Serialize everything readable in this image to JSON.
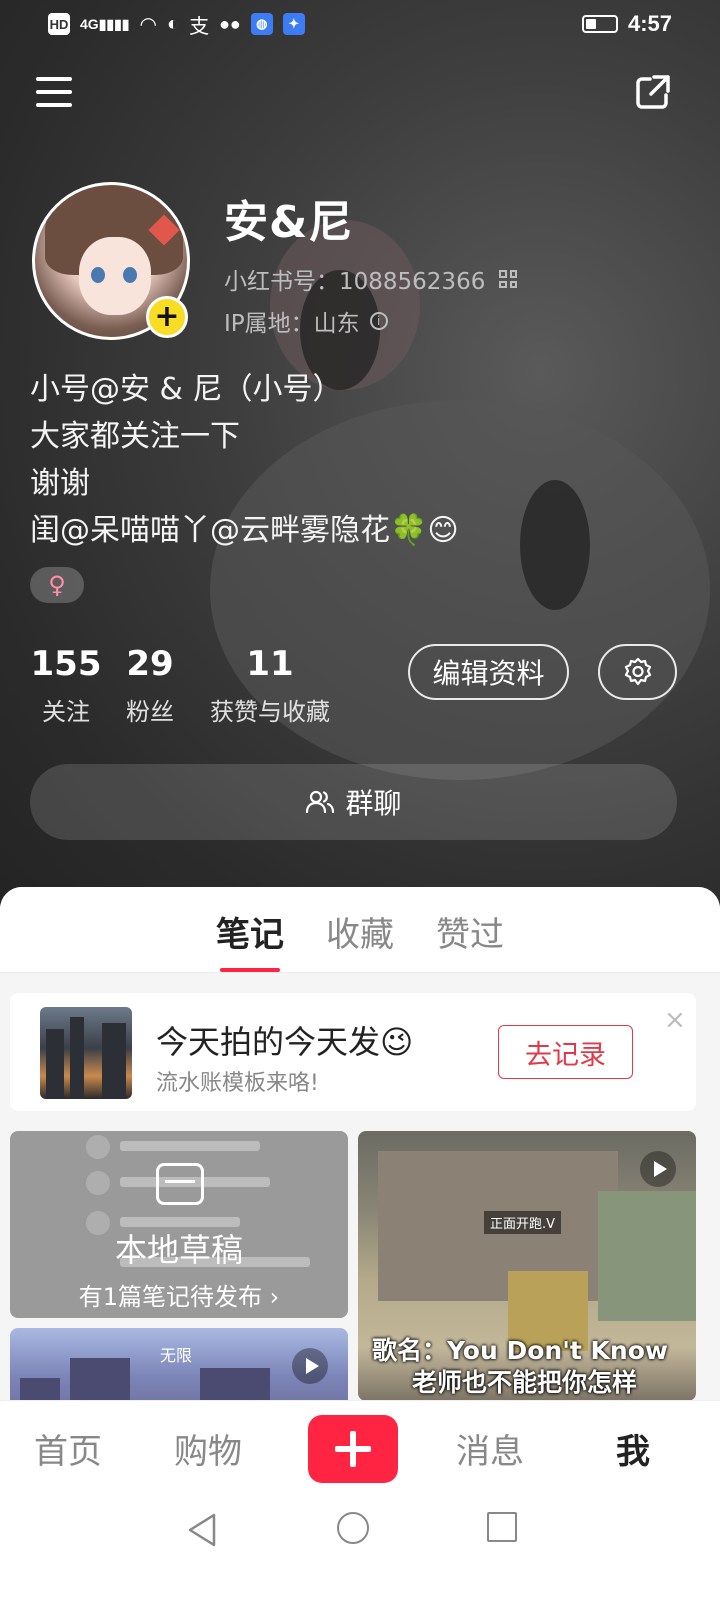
{
  "status_bar": {
    "left_labels": [
      "HD",
      "4G"
    ],
    "time": "4:57",
    "alipay_glyph": "支"
  },
  "profile": {
    "name": "安&尼",
    "id_label": "小红书号：1088562366",
    "ip_label": "IP属地：山东",
    "add_glyph": "+",
    "bio_lines": [
      "小号@安 & 尼（小号）",
      "大家都关注一下",
      "谢谢",
      "闺@呆喵喵丫@云畔雾隐花🍀😊"
    ],
    "gender_symbol": "♀",
    "gender_color": "#ff8fa4"
  },
  "stats": [
    {
      "value": "155",
      "label": "关注"
    },
    {
      "value": "29",
      "label": "粉丝"
    },
    {
      "value": "11",
      "label": "获赞与收藏"
    }
  ],
  "actions": {
    "edit_label": "编辑资料",
    "group_chat_label": "群聊"
  },
  "tabs": [
    {
      "label": "笔记",
      "active": true
    },
    {
      "label": "收藏",
      "active": false
    },
    {
      "label": "赞过",
      "active": false
    }
  ],
  "promo": {
    "title": "今天拍的今天发😉",
    "subtitle": "流水账模板来咯!",
    "button_label": "去记录",
    "close_glyph": "×"
  },
  "drafts_card": {
    "title": "本地草稿",
    "subtitle": "有1篇笔记待发布 ›"
  },
  "video_card": {
    "small_label": "正面开跑.V",
    "caption_line1": "歌名：You Don't Know",
    "caption_line2": "老师也不能把你怎样"
  },
  "image_card": {
    "small_label": "无限"
  },
  "bottom_nav": {
    "home": "首页",
    "shop": "购物",
    "messages": "消息",
    "me": "我"
  },
  "colors": {
    "brand_red": "#ff2442",
    "avatar_badge": "#f9dc24"
  }
}
